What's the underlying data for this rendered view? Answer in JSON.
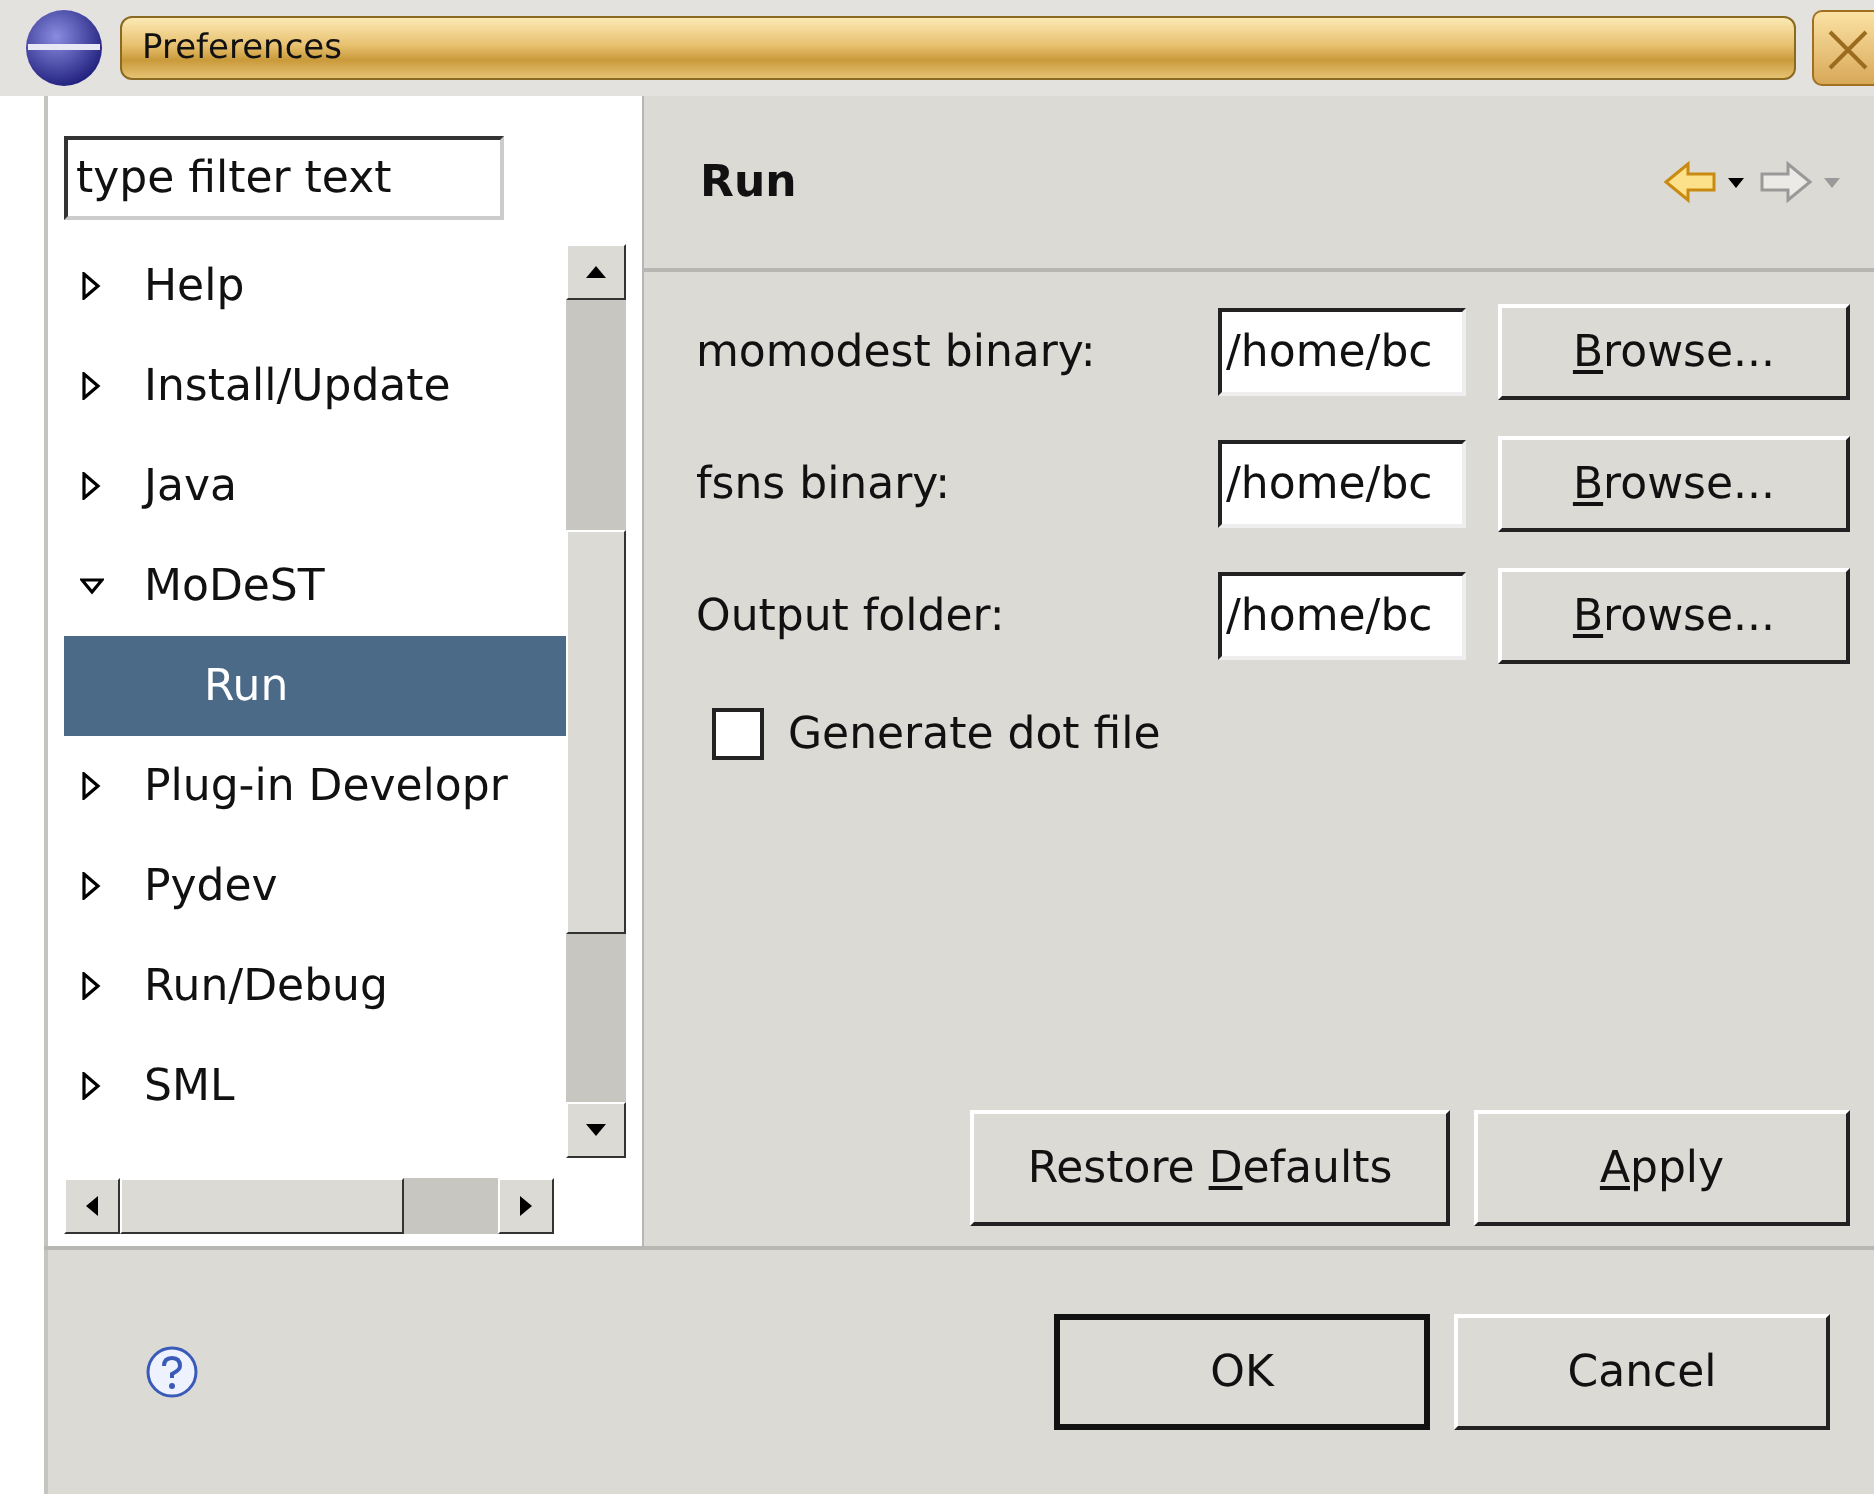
{
  "window": {
    "title": "Preferences"
  },
  "filter": {
    "placeholder": "type filter text"
  },
  "tree": [
    {
      "label": "Help",
      "expanded": false,
      "selected": false
    },
    {
      "label": "Install/Update",
      "expanded": false,
      "selected": false
    },
    {
      "label": "Java",
      "expanded": false,
      "selected": false
    },
    {
      "label": "MoDeST",
      "expanded": true,
      "selected": false,
      "children": [
        {
          "label": "Run",
          "selected": true
        }
      ]
    },
    {
      "label": "Plug-in Developr",
      "expanded": false,
      "selected": false
    },
    {
      "label": "Pydev",
      "expanded": false,
      "selected": false
    },
    {
      "label": "Run/Debug",
      "expanded": false,
      "selected": false
    },
    {
      "label": "SML",
      "expanded": false,
      "selected": false
    }
  ],
  "page": {
    "title": "Run",
    "fields": [
      {
        "label": "momodest binary:",
        "value": "/home/bc",
        "button": {
          "key": "B",
          "rest": "rowse..."
        }
      },
      {
        "label": "fsns binary:",
        "value": "/home/bc",
        "button": {
          "key": "B",
          "rest": "rowse..."
        }
      },
      {
        "label": "Output folder:",
        "value": "/home/bc",
        "button": {
          "key": "B",
          "rest": "rowse..."
        }
      }
    ],
    "checkbox": {
      "label": "Generate dot file",
      "checked": false
    },
    "buttons": [
      {
        "before": "Restore ",
        "key": "D",
        "rest": "efaults"
      },
      {
        "key": "A",
        "rest": "pply"
      }
    ]
  },
  "dialog_buttons": [
    "OK",
    "Cancel"
  ]
}
